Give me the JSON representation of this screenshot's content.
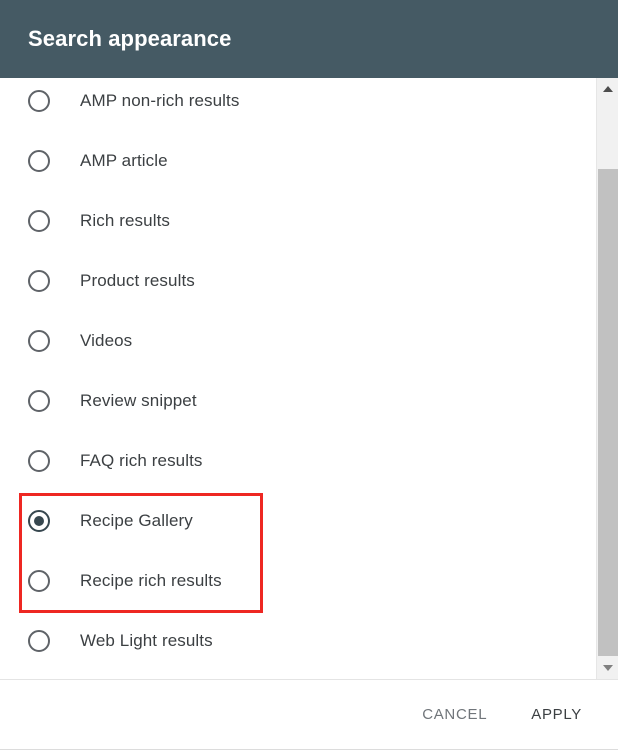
{
  "dialog": {
    "title": "Search appearance",
    "header_color": "#455A64",
    "highlight_color": "#EE2722"
  },
  "options": [
    {
      "label": "AMP non-rich results",
      "selected": false
    },
    {
      "label": "AMP article",
      "selected": false
    },
    {
      "label": "Rich results",
      "selected": false
    },
    {
      "label": "Product results",
      "selected": false
    },
    {
      "label": "Videos",
      "selected": false
    },
    {
      "label": "Review snippet",
      "selected": false
    },
    {
      "label": "FAQ rich results",
      "selected": false
    },
    {
      "label": "Recipe Gallery",
      "selected": true
    },
    {
      "label": "Recipe rich results",
      "selected": false
    },
    {
      "label": "Web Light results",
      "selected": false
    }
  ],
  "scrollbar": {
    "up_arrow": "triangle-up-icon",
    "down_arrow": "triangle-down-icon"
  },
  "footer": {
    "cancel_label": "CANCEL",
    "apply_label": "APPLY"
  }
}
